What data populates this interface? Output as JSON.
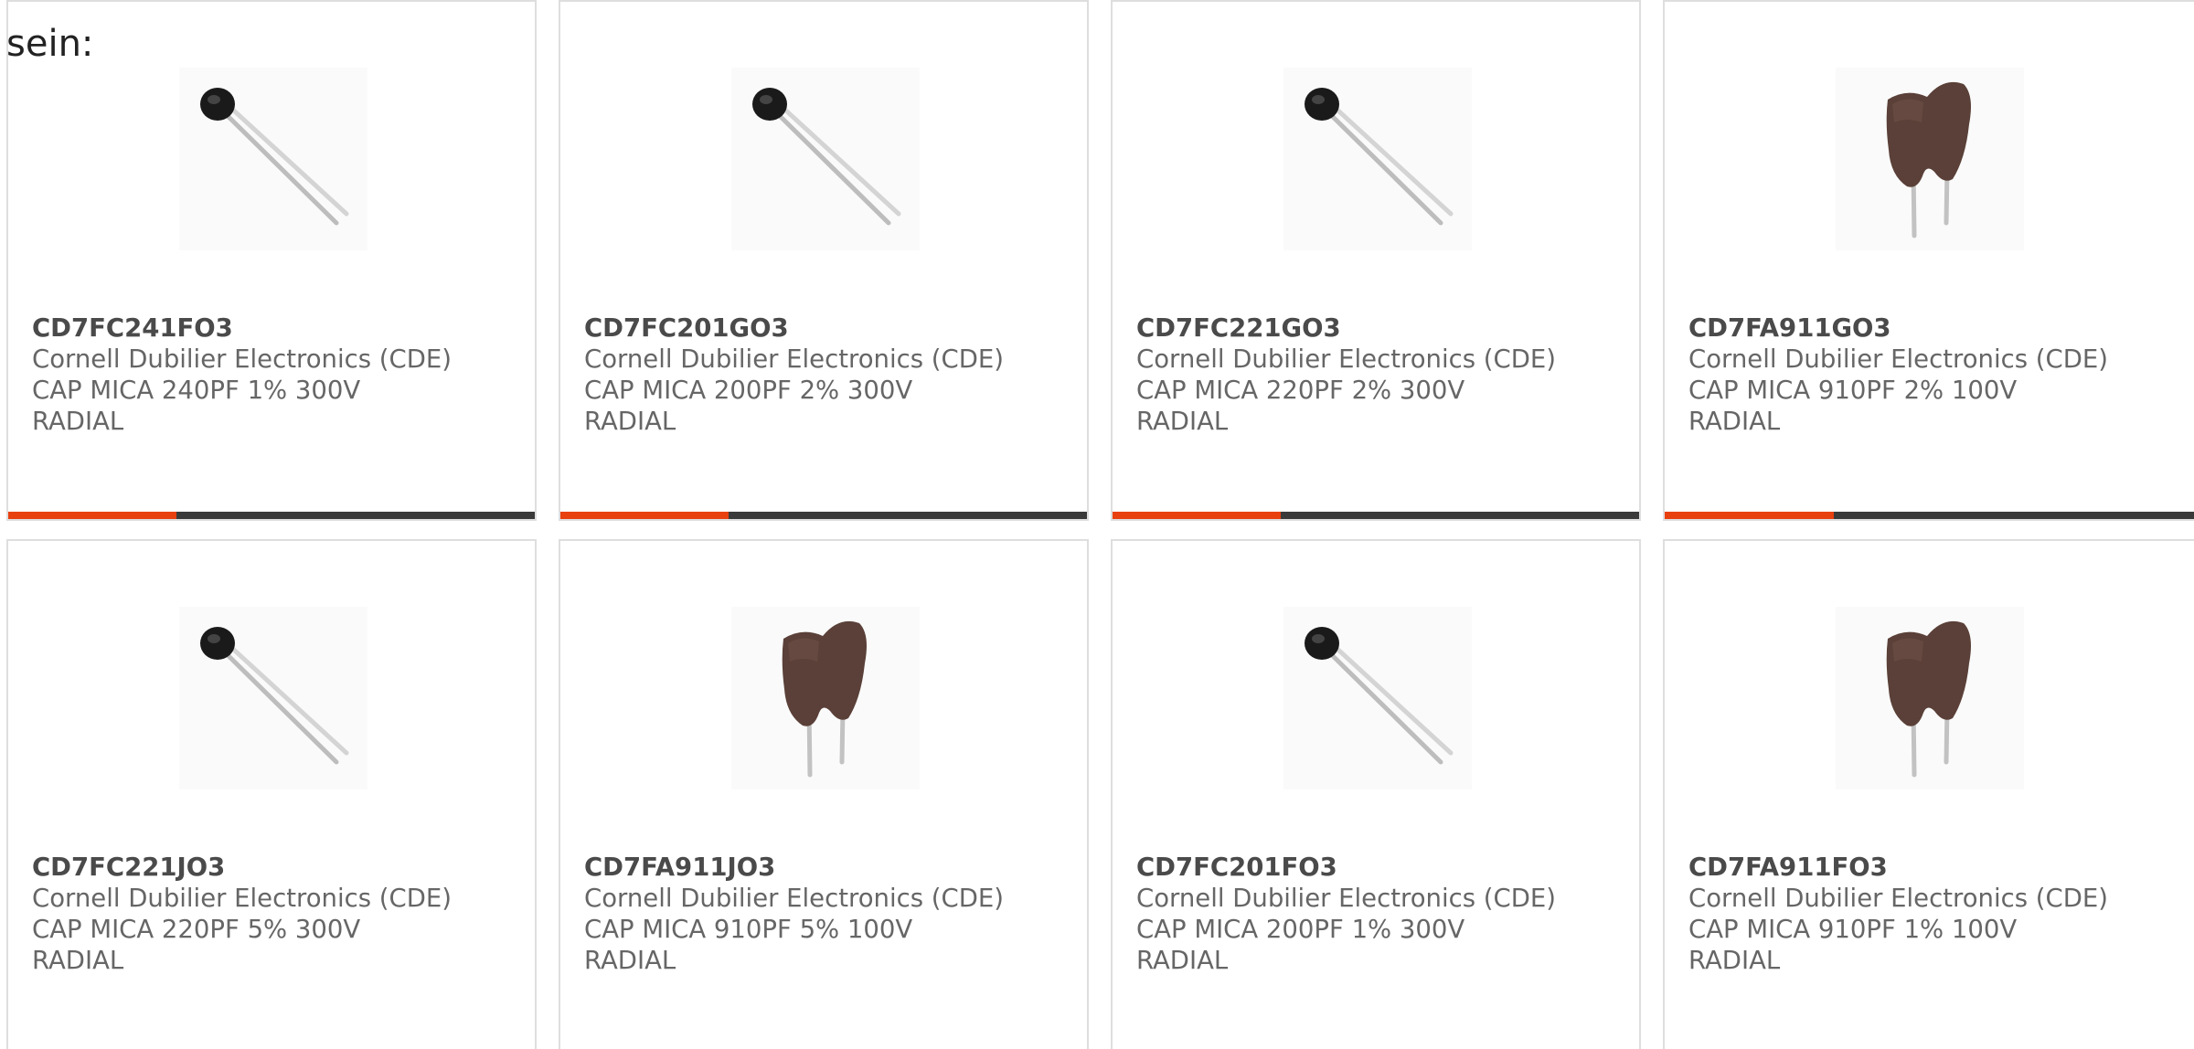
{
  "intro_text": "sein:",
  "accent_color": "#e8400f",
  "products": [
    {
      "part_number": "CD7FC241FO3",
      "manufacturer": "Cornell Dubilier Electronics (CDE)",
      "description_line1": "CAP MICA 240PF 1% 300V",
      "description_line2": "RADIAL",
      "image_icon": "disc-capacitor-icon",
      "indicator_fill": 0.32
    },
    {
      "part_number": "CD7FC201GO3",
      "manufacturer": "Cornell Dubilier Electronics (CDE)",
      "description_line1": "CAP MICA 200PF 2% 300V",
      "description_line2": "RADIAL",
      "image_icon": "disc-capacitor-icon",
      "indicator_fill": 0.32
    },
    {
      "part_number": "CD7FC221GO3",
      "manufacturer": "Cornell Dubilier Electronics (CDE)",
      "description_line1": "CAP MICA 220PF 2% 300V",
      "description_line2": "RADIAL",
      "image_icon": "disc-capacitor-icon",
      "indicator_fill": 0.32
    },
    {
      "part_number": "CD7FA911GO3",
      "manufacturer": "Cornell Dubilier Electronics (CDE)",
      "description_line1": "CAP MICA 910PF 2% 100V",
      "description_line2": "RADIAL",
      "image_icon": "dipped-capacitor-icon",
      "indicator_fill": 0.32
    },
    {
      "part_number": "CD7FC221JO3",
      "manufacturer": "Cornell Dubilier Electronics (CDE)",
      "description_line1": "CAP MICA 220PF 5% 300V",
      "description_line2": "RADIAL",
      "image_icon": "disc-capacitor-icon"
    },
    {
      "part_number": "CD7FA911JO3",
      "manufacturer": "Cornell Dubilier Electronics (CDE)",
      "description_line1": "CAP MICA 910PF 5% 100V",
      "description_line2": "RADIAL",
      "image_icon": "dipped-capacitor-icon"
    },
    {
      "part_number": "CD7FC201FO3",
      "manufacturer": "Cornell Dubilier Electronics (CDE)",
      "description_line1": "CAP MICA 200PF 1% 300V",
      "description_line2": "RADIAL",
      "image_icon": "disc-capacitor-icon"
    },
    {
      "part_number": "CD7FA911FO3",
      "manufacturer": "Cornell Dubilier Electronics (CDE)",
      "description_line1": "CAP MICA 910PF 1% 100V",
      "description_line2": "RADIAL",
      "image_icon": "dipped-capacitor-icon"
    }
  ]
}
